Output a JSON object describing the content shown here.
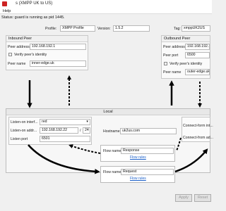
{
  "window": {
    "title": "s (XMPP UK to US)"
  },
  "menu": {
    "help": "Help"
  },
  "status": {
    "text": "Status:  guard is running as pid 1445."
  },
  "profile": {
    "label": "Profile:",
    "value": "XMPP Profile"
  },
  "version": {
    "label": "Version:",
    "value": "1.5.2"
  },
  "tag": {
    "label": "Tag:",
    "value": "xmppUK2US"
  },
  "inbound": {
    "title": "Inbound Peer",
    "address_label": "Peer address",
    "address_value": "192.168.192.1",
    "verify_label": "Verify peer's identity",
    "name_label": "Peer name",
    "name_value": "inner-edge.uk"
  },
  "outbound": {
    "title": "Outbound Peer",
    "address_label": "Peer address",
    "address_value": "192.168.192.1",
    "port_label": "Peer port",
    "port_value": "6500",
    "verify_label": "Verify peer's identity",
    "name_label": "Peer name",
    "name_value": "outer-edge.uk"
  },
  "local": {
    "title": "Local",
    "iface_label": "Listen-on interf...",
    "iface_value": "red",
    "addr_label": "Listen-on addr...",
    "addr_value": "192.168.192.22",
    "slash": "/",
    "prefix_value": "24",
    "port_label": "Listen port",
    "port_value": "6501",
    "hostname_label": "Hostname",
    "hostname_value": "uk2us.com",
    "connect_form_int": "Connect-form int...",
    "connect_from_ad": "Connect-from ad..."
  },
  "flows": {
    "response": {
      "label": "Flow name",
      "value": "Response",
      "link": "Flow rules"
    },
    "request": {
      "label": "Flow name",
      "value": "Request",
      "link": "Flow rules"
    }
  },
  "buttons": {
    "apply": "Apply",
    "reset": "Reset"
  },
  "colors": {
    "accent": "#1a5fc9",
    "background": "#f0f0f0"
  }
}
